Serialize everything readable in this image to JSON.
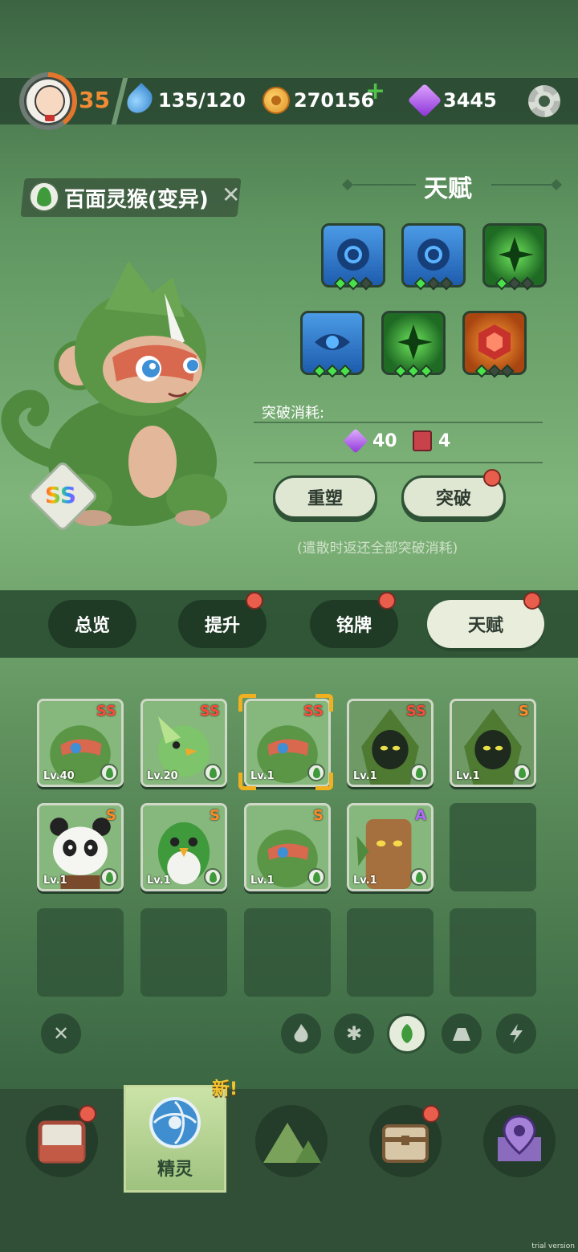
{
  "top_bar": {
    "level": "35",
    "energy": "135/120",
    "coins": "270156",
    "gems": "3445"
  },
  "pet": {
    "name": "百面灵猴(变异)",
    "grade": "SS"
  },
  "talent": {
    "title": "天赋",
    "nodes": [
      {
        "color": "blue",
        "icon": "gear-ring-icon",
        "stars_on": 2,
        "stars_total": 3
      },
      {
        "color": "blue",
        "icon": "gear-ring-icon",
        "stars_on": 1,
        "stars_total": 3
      },
      {
        "color": "green",
        "icon": "leaf-shuriken-icon",
        "stars_on": 1,
        "stars_total": 3
      },
      {
        "color": "blue",
        "icon": "eye-icon",
        "stars_on": 3,
        "stars_total": 3
      },
      {
        "color": "green",
        "icon": "leaf-shuriken-icon",
        "stars_on": 3,
        "stars_total": 3
      },
      {
        "color": "orange",
        "icon": "hexagon-gem-icon",
        "stars_on": 1,
        "stars_total": 3
      }
    ],
    "cost_label": "突破消耗:",
    "cost_gem": "40",
    "cost_book": "4",
    "reshape_label": "重塑",
    "breakthrough_label": "突破",
    "hint": "(遣散时返还全部突破消耗)"
  },
  "tabs": [
    {
      "label": "总览",
      "badge": false,
      "active": false
    },
    {
      "label": "提升",
      "badge": true,
      "active": false
    },
    {
      "label": "铭牌",
      "badge": true,
      "active": false
    },
    {
      "label": "天赋",
      "badge": true,
      "active": true
    }
  ],
  "pets": [
    {
      "rank": "SS",
      "level": "Lv.40",
      "kind": "monkey"
    },
    {
      "rank": "SS",
      "level": "Lv.20",
      "kind": "bird"
    },
    {
      "rank": "SS",
      "level": "Lv.1",
      "kind": "monkey",
      "selected": true
    },
    {
      "rank": "SS",
      "level": "Lv.1",
      "kind": "hood"
    },
    {
      "rank": "S",
      "level": "Lv.1",
      "kind": "hood"
    },
    {
      "rank": "S",
      "level": "Lv.1",
      "kind": "panda"
    },
    {
      "rank": "S",
      "level": "Lv.1",
      "kind": "parrot"
    },
    {
      "rank": "S",
      "level": "Lv.1",
      "kind": "monkey"
    },
    {
      "rank": "A",
      "level": "Lv.1",
      "kind": "treant"
    }
  ],
  "filters": [
    "close-icon",
    "fire-icon",
    "gear-flower-icon",
    "leaf-icon",
    "rock-icon",
    "lightning-icon"
  ],
  "bottom_nav": {
    "items": [
      {
        "icon": "backpack-icon",
        "badge": true
      },
      {
        "icon": "spirit-orb-icon",
        "label": "精灵",
        "active": true
      },
      {
        "icon": "mountain-icon",
        "badge": false
      },
      {
        "icon": "chest-icon",
        "badge": true
      },
      {
        "icon": "map-pin-icon",
        "badge": false
      }
    ],
    "new_label": "新!"
  },
  "watermark": "trial version",
  "colors": {
    "accent_orange": "#f28b35",
    "badge_red": "#e95d4c",
    "active_green": "#4ae24a"
  }
}
